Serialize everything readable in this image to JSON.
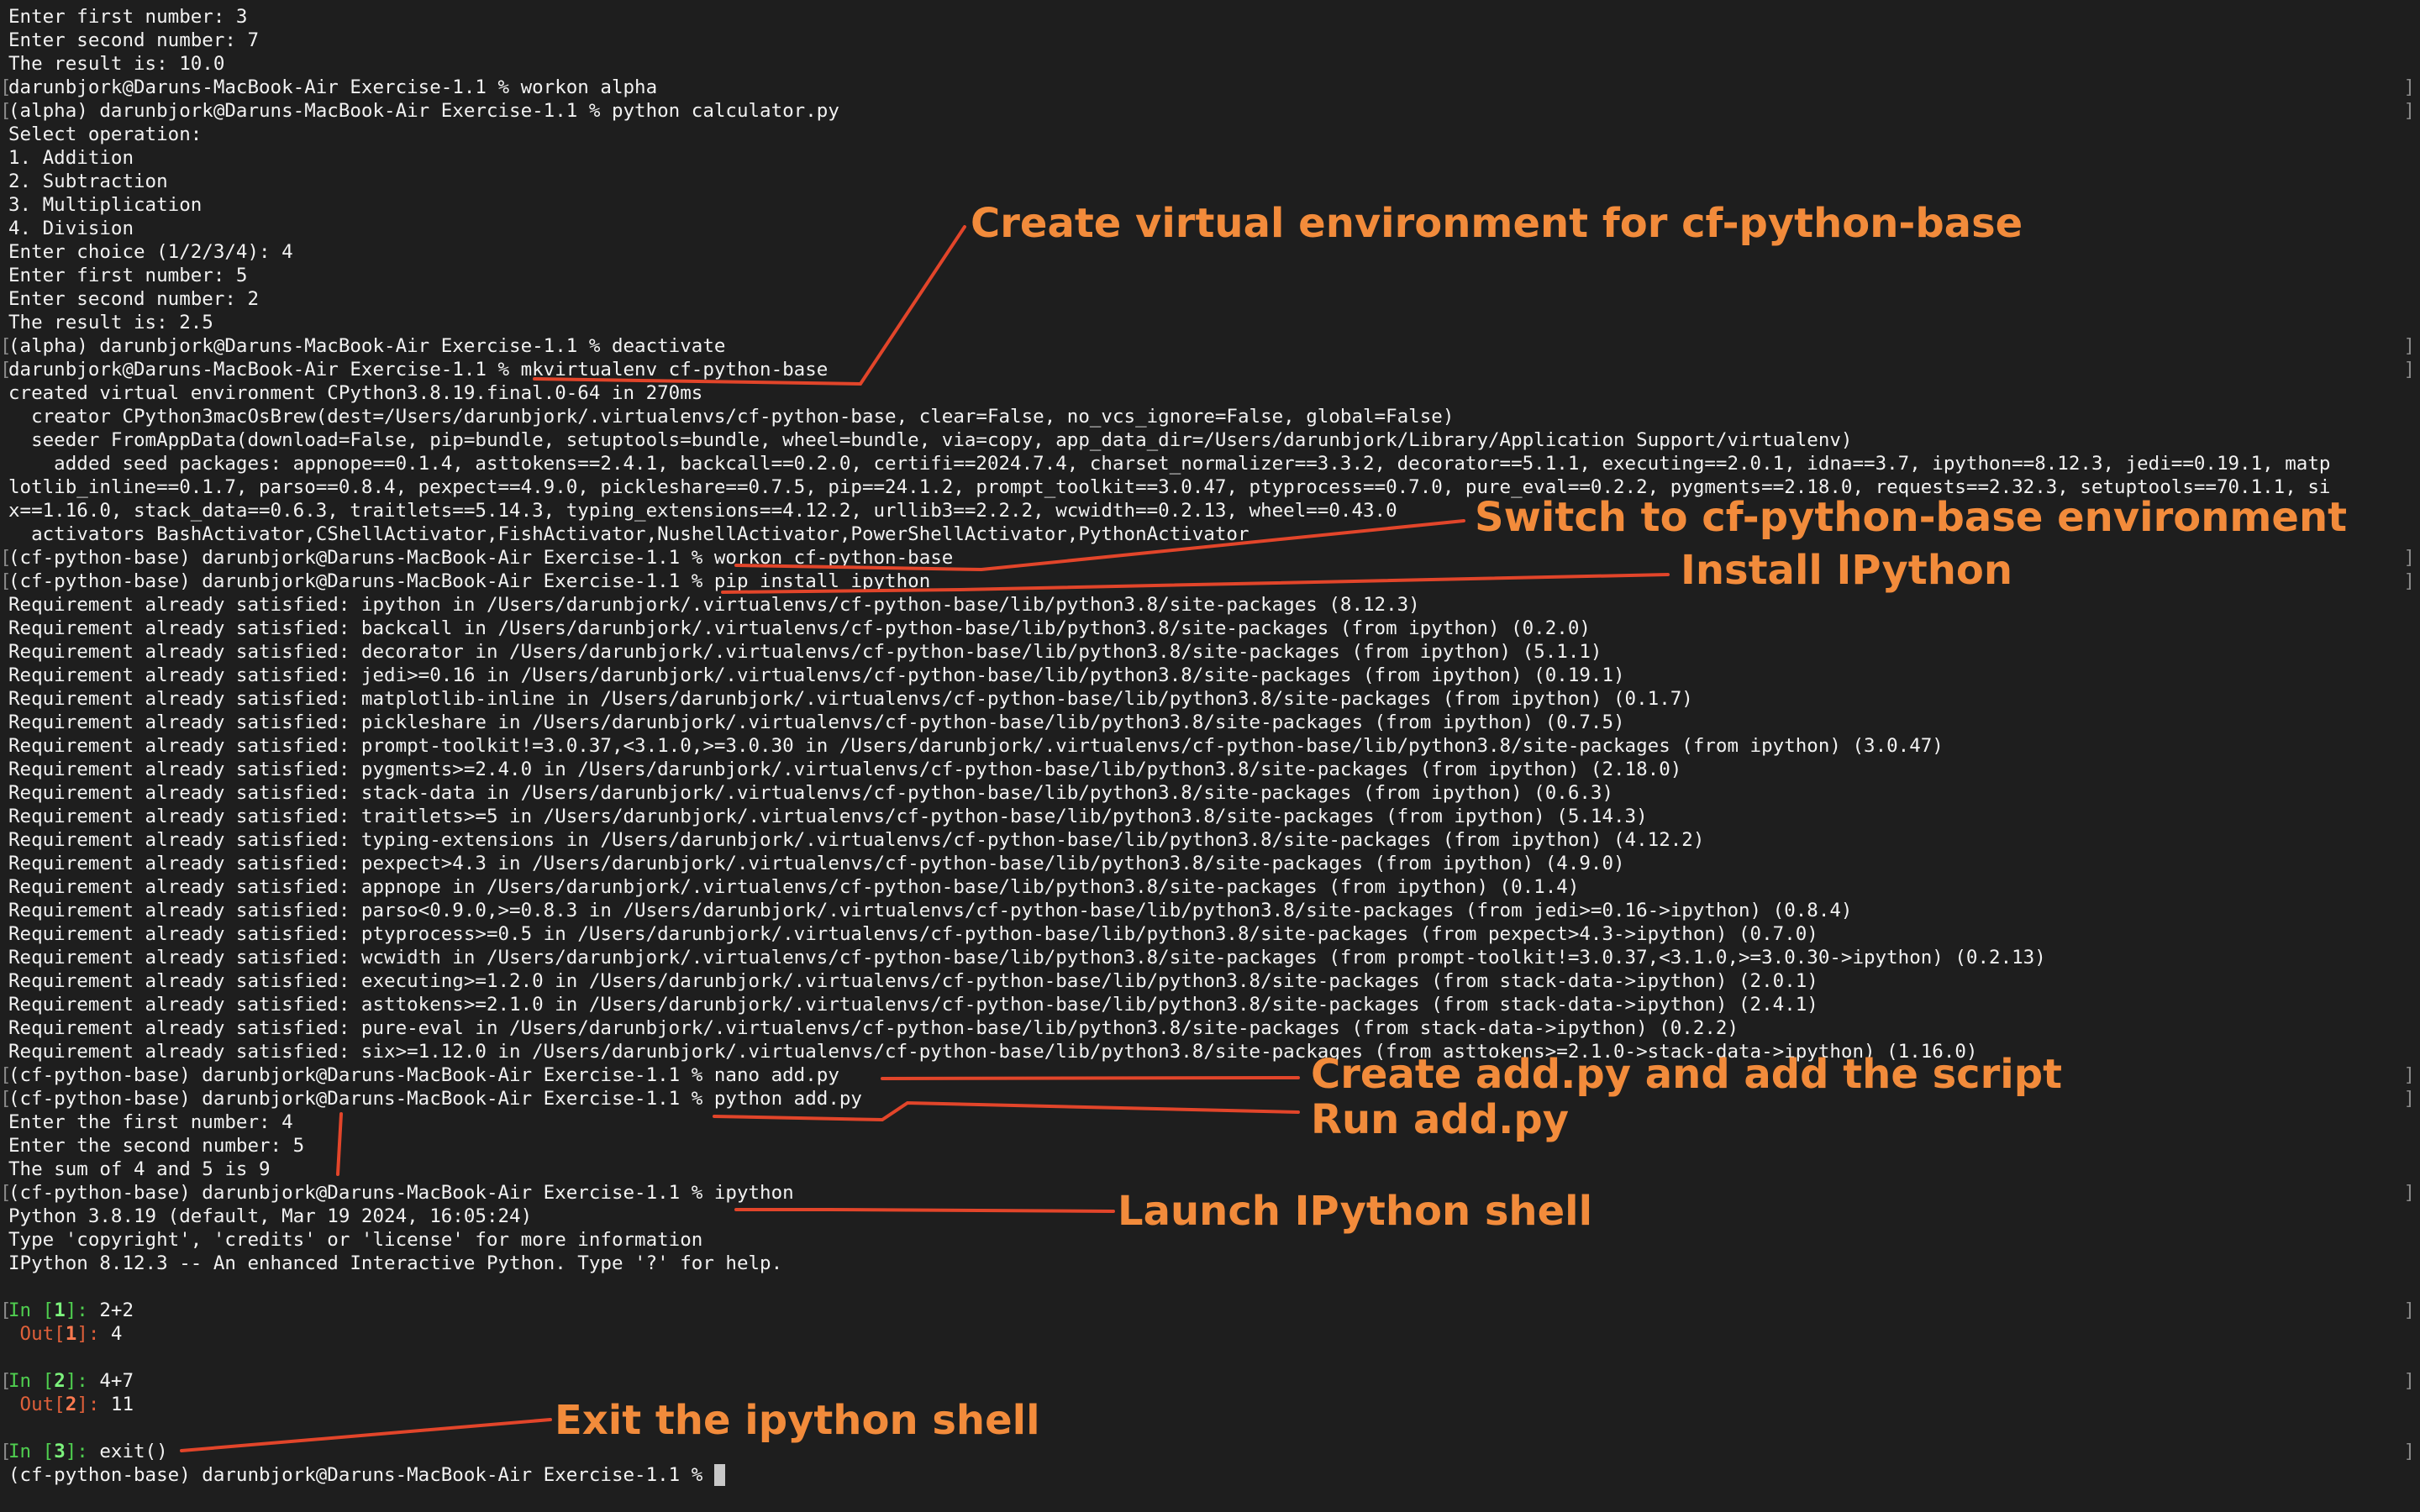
{
  "terminal": {
    "lines": [
      {
        "text": "Enter first number: 3"
      },
      {
        "text": "Enter second number: 7"
      },
      {
        "text": "The result is: 10.0"
      },
      {
        "text": "darunbjork@Daruns-MacBook-Air Exercise-1.1 % workon alpha",
        "marks": true
      },
      {
        "text": "(alpha) darunbjork@Daruns-MacBook-Air Exercise-1.1 % python calculator.py",
        "marks": true
      },
      {
        "text": "Select operation:"
      },
      {
        "text": "1. Addition"
      },
      {
        "text": "2. Subtraction"
      },
      {
        "text": "3. Multiplication"
      },
      {
        "text": "4. Division"
      },
      {
        "text": "Enter choice (1/2/3/4): 4"
      },
      {
        "text": "Enter first number: 5"
      },
      {
        "text": "Enter second number: 2"
      },
      {
        "text": "The result is: 2.5"
      },
      {
        "text": "(alpha) darunbjork@Daruns-MacBook-Air Exercise-1.1 % deactivate",
        "marks": true
      },
      {
        "text": "darunbjork@Daruns-MacBook-Air Exercise-1.1 % mkvirtualenv cf-python-base",
        "marks": true
      },
      {
        "text": "created virtual environment CPython3.8.19.final.0-64 in 270ms"
      },
      {
        "text": "  creator CPython3macOsBrew(dest=/Users/darunbjork/.virtualenvs/cf-python-base, clear=False, no_vcs_ignore=False, global=False)"
      },
      {
        "text": "  seeder FromAppData(download=False, pip=bundle, setuptools=bundle, wheel=bundle, via=copy, app_data_dir=/Users/darunbjork/Library/Application Support/virtualenv)"
      },
      {
        "text": "    added seed packages: appnope==0.1.4, asttokens==2.4.1, backcall==0.2.0, certifi==2024.7.4, charset_normalizer==3.3.2, decorator==5.1.1, executing==2.0.1, idna==3.7, ipython==8.12.3, jedi==0.19.1, matp"
      },
      {
        "text": "lotlib_inline==0.1.7, parso==0.8.4, pexpect==4.9.0, pickleshare==0.7.5, pip==24.1.2, prompt_toolkit==3.0.47, ptyprocess==0.7.0, pure_eval==0.2.2, pygments==2.18.0, requests==2.32.3, setuptools==70.1.1, si"
      },
      {
        "text": "x==1.16.0, stack_data==0.6.3, traitlets==5.14.3, typing_extensions==4.12.2, urllib3==2.2.2, wcwidth==0.2.13, wheel==0.43.0"
      },
      {
        "text": "  activators BashActivator,CShellActivator,FishActivator,NushellActivator,PowerShellActivator,PythonActivator"
      },
      {
        "text": "(cf-python-base) darunbjork@Daruns-MacBook-Air Exercise-1.1 % workon cf-python-base",
        "marks": true
      },
      {
        "text": "(cf-python-base) darunbjork@Daruns-MacBook-Air Exercise-1.1 % pip install ipython",
        "marks": true
      },
      {
        "text": "Requirement already satisfied: ipython in /Users/darunbjork/.virtualenvs/cf-python-base/lib/python3.8/site-packages (8.12.3)"
      },
      {
        "text": "Requirement already satisfied: backcall in /Users/darunbjork/.virtualenvs/cf-python-base/lib/python3.8/site-packages (from ipython) (0.2.0)"
      },
      {
        "text": "Requirement already satisfied: decorator in /Users/darunbjork/.virtualenvs/cf-python-base/lib/python3.8/site-packages (from ipython) (5.1.1)"
      },
      {
        "text": "Requirement already satisfied: jedi>=0.16 in /Users/darunbjork/.virtualenvs/cf-python-base/lib/python3.8/site-packages (from ipython) (0.19.1)"
      },
      {
        "text": "Requirement already satisfied: matplotlib-inline in /Users/darunbjork/.virtualenvs/cf-python-base/lib/python3.8/site-packages (from ipython) (0.1.7)"
      },
      {
        "text": "Requirement already satisfied: pickleshare in /Users/darunbjork/.virtualenvs/cf-python-base/lib/python3.8/site-packages (from ipython) (0.7.5)"
      },
      {
        "text": "Requirement already satisfied: prompt-toolkit!=3.0.37,<3.1.0,>=3.0.30 in /Users/darunbjork/.virtualenvs/cf-python-base/lib/python3.8/site-packages (from ipython) (3.0.47)"
      },
      {
        "text": "Requirement already satisfied: pygments>=2.4.0 in /Users/darunbjork/.virtualenvs/cf-python-base/lib/python3.8/site-packages (from ipython) (2.18.0)"
      },
      {
        "text": "Requirement already satisfied: stack-data in /Users/darunbjork/.virtualenvs/cf-python-base/lib/python3.8/site-packages (from ipython) (0.6.3)"
      },
      {
        "text": "Requirement already satisfied: traitlets>=5 in /Users/darunbjork/.virtualenvs/cf-python-base/lib/python3.8/site-packages (from ipython) (5.14.3)"
      },
      {
        "text": "Requirement already satisfied: typing-extensions in /Users/darunbjork/.virtualenvs/cf-python-base/lib/python3.8/site-packages (from ipython) (4.12.2)"
      },
      {
        "text": "Requirement already satisfied: pexpect>4.3 in /Users/darunbjork/.virtualenvs/cf-python-base/lib/python3.8/site-packages (from ipython) (4.9.0)"
      },
      {
        "text": "Requirement already satisfied: appnope in /Users/darunbjork/.virtualenvs/cf-python-base/lib/python3.8/site-packages (from ipython) (0.1.4)"
      },
      {
        "text": "Requirement already satisfied: parso<0.9.0,>=0.8.3 in /Users/darunbjork/.virtualenvs/cf-python-base/lib/python3.8/site-packages (from jedi>=0.16->ipython) (0.8.4)"
      },
      {
        "text": "Requirement already satisfied: ptyprocess>=0.5 in /Users/darunbjork/.virtualenvs/cf-python-base/lib/python3.8/site-packages (from pexpect>4.3->ipython) (0.7.0)"
      },
      {
        "text": "Requirement already satisfied: wcwidth in /Users/darunbjork/.virtualenvs/cf-python-base/lib/python3.8/site-packages (from prompt-toolkit!=3.0.37,<3.1.0,>=3.0.30->ipython) (0.2.13)"
      },
      {
        "text": "Requirement already satisfied: executing>=1.2.0 in /Users/darunbjork/.virtualenvs/cf-python-base/lib/python3.8/site-packages (from stack-data->ipython) (2.0.1)"
      },
      {
        "text": "Requirement already satisfied: asttokens>=2.1.0 in /Users/darunbjork/.virtualenvs/cf-python-base/lib/python3.8/site-packages (from stack-data->ipython) (2.4.1)"
      },
      {
        "text": "Requirement already satisfied: pure-eval in /Users/darunbjork/.virtualenvs/cf-python-base/lib/python3.8/site-packages (from stack-data->ipython) (0.2.2)"
      },
      {
        "text": "Requirement already satisfied: six>=1.12.0 in /Users/darunbjork/.virtualenvs/cf-python-base/lib/python3.8/site-packages (from asttokens>=2.1.0->stack-data->ipython) (1.16.0)"
      },
      {
        "text": "(cf-python-base) darunbjork@Daruns-MacBook-Air Exercise-1.1 % nano add.py",
        "marks": true
      },
      {
        "text": "(cf-python-base) darunbjork@Daruns-MacBook-Air Exercise-1.1 % python add.py",
        "marks": true
      },
      {
        "text": "Enter the first number: 4"
      },
      {
        "text": "Enter the second number: 5"
      },
      {
        "text": "The sum of 4 and 5 is 9"
      },
      {
        "text": "(cf-python-base) darunbjork@Daruns-MacBook-Air Exercise-1.1 % ipython",
        "marks": true
      },
      {
        "text": "Python 3.8.19 (default, Mar 19 2024, 16:05:24)"
      },
      {
        "text": "Type 'copyright', 'credits' or 'license' for more information"
      },
      {
        "text": "IPython 8.12.3 -- An enhanced Interactive Python. Type '?' for help."
      },
      {
        "text": ""
      },
      {
        "kind": "in",
        "n": "1",
        "code": "2+2",
        "marks": true
      },
      {
        "kind": "out",
        "n": "1",
        "text": "4"
      },
      {
        "text": ""
      },
      {
        "kind": "in",
        "n": "2",
        "code": "4+7",
        "marks": true
      },
      {
        "kind": "out",
        "n": "2",
        "text": "11"
      },
      {
        "text": ""
      },
      {
        "kind": "in",
        "n": "3",
        "code": "exit()",
        "marks": true
      },
      {
        "text": "(cf-python-base) darunbjork@Daruns-MacBook-Air Exercise-1.1 % ",
        "cursor": true
      }
    ]
  },
  "annotations": [
    {
      "id": "create-venv",
      "text": "Create virtual environment for cf-python-base"
    },
    {
      "id": "switch-env",
      "text": "Switch to cf-python-base environment"
    },
    {
      "id": "install-ipython",
      "text": "Install IPython"
    },
    {
      "id": "create-add",
      "text": "Create add.py and add the script"
    },
    {
      "id": "run-add",
      "text": "Run add.py"
    },
    {
      "id": "launch-ipython",
      "text": "Launch IPython shell"
    },
    {
      "id": "exit-ipython",
      "text": "Exit the ipython shell"
    }
  ],
  "colors": {
    "background": "#1e1e1e",
    "text": "#f2f2f2",
    "annotation": "#f28b3b",
    "annotation_line": "#e2452a",
    "ipython_in": "#4fce4f",
    "ipython_out": "#e0603a"
  }
}
